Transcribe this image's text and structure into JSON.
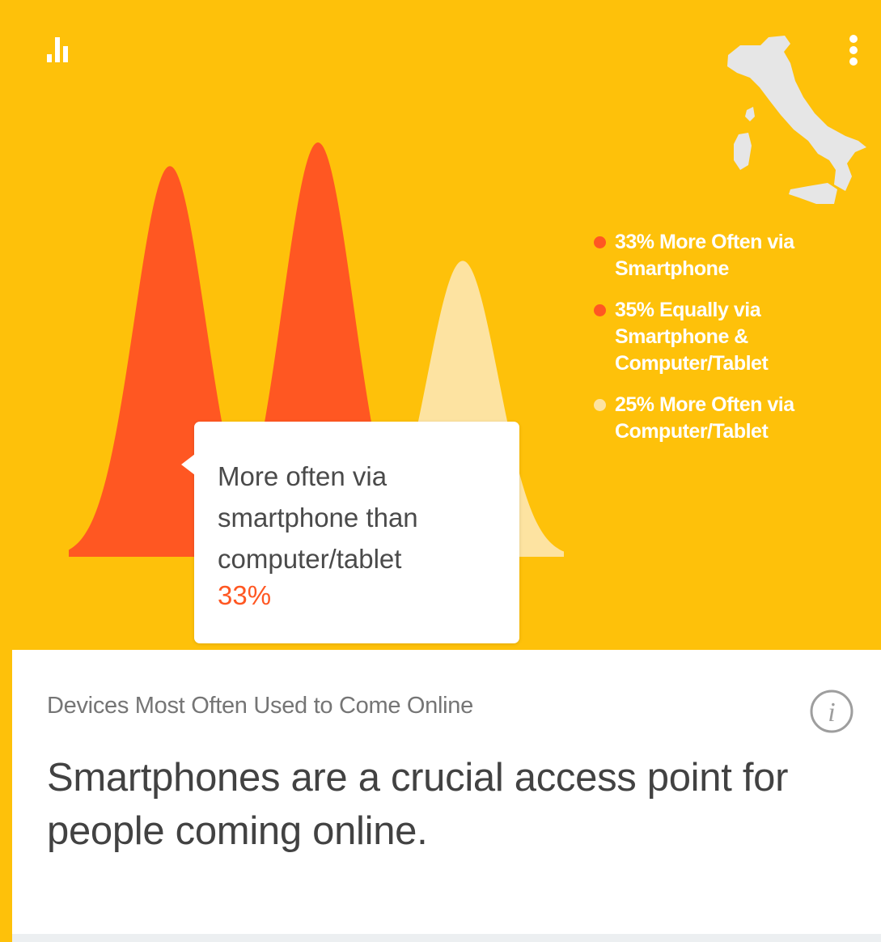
{
  "colors": {
    "background": "#fec10a",
    "series_smartphone": "#ff5722",
    "series_equal": "#ff5722",
    "series_computer": "#fde3a1",
    "tooltip_value": "#ff5722",
    "legend_text": "#ffffff"
  },
  "icons": {
    "chart": "bar-chart-icon",
    "menu": "more-vert-icon",
    "info": "info-icon",
    "map": "italy-map"
  },
  "legend": [
    {
      "label": "33% More Often via Smartphone",
      "line1": "33% More Often via",
      "line2": "Smartphone",
      "color": "#ff5722"
    },
    {
      "label": "35% Equally via Smartphone & Computer/Tablet",
      "line1": "35% Equally via",
      "line2": "Smartphone &",
      "line3": "Computer/Tablet",
      "color": "#ff5722"
    },
    {
      "label": "25% More Often via Computer/Tablet",
      "line1": "25% More Often via",
      "line2": "Computer/Tablet",
      "color": "#fde3a1"
    }
  ],
  "tooltip": {
    "line1": "More often via",
    "line2": "smartphone than",
    "line3": "computer/tablet",
    "value": "33%"
  },
  "card": {
    "subtitle": "Devices Most Often Used to Come Online",
    "headline": "Smartphones are a crucial access point for people coming online."
  },
  "chart_data": {
    "type": "area",
    "categories": [
      "More often via smartphone",
      "Equally via smartphone & computer/tablet",
      "More often via computer/tablet"
    ],
    "values": [
      33,
      35,
      25
    ],
    "units": "%",
    "ylim": [
      0,
      35
    ]
  }
}
